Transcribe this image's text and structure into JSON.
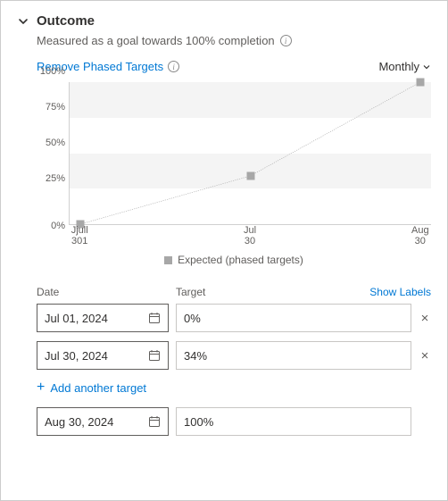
{
  "header": {
    "title": "Outcome",
    "subtitle": "Measured as a goal towards 100% completion"
  },
  "controls": {
    "remove_phased": "Remove Phased Targets",
    "period": "Monthly"
  },
  "chart_data": {
    "type": "line",
    "categories": [
      "Jul 01",
      "Jul 30",
      "Aug 30"
    ],
    "values": [
      0,
      34,
      100
    ],
    "title": "",
    "xlabel": "",
    "ylabel": "",
    "ylim": [
      0,
      100
    ],
    "yticks": [
      "0%",
      "25%",
      "50%",
      "75%",
      "100%"
    ],
    "xticks": [
      {
        "line1": "Jjull",
        "line2": "301"
      },
      {
        "line1": "Jul",
        "line2": "30"
      },
      {
        "line1": "Aug",
        "line2": "30"
      }
    ],
    "legend": "Expected (phased targets)"
  },
  "targets_table": {
    "headers": {
      "date": "Date",
      "target": "Target",
      "show_labels": "Show Labels"
    },
    "rows": [
      {
        "date": "Jul 01, 2024",
        "target": "0%",
        "removable": true
      },
      {
        "date": "Jul 30, 2024",
        "target": "34%",
        "removable": true
      }
    ],
    "add_label": "Add another target",
    "final_row": {
      "date": "Aug 30, 2024",
      "target": "100%",
      "removable": false
    }
  }
}
